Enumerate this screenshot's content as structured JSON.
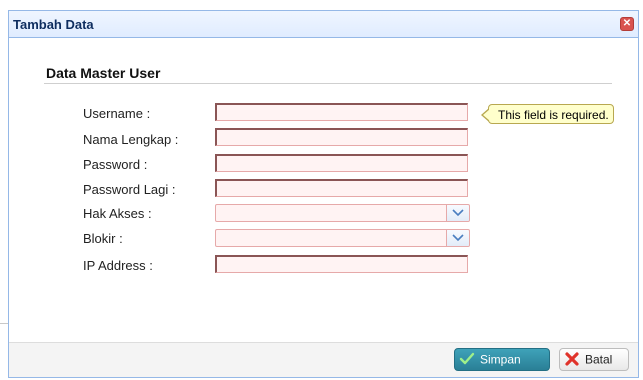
{
  "dialog": {
    "title": "Tambah Data",
    "close_icon": "close-icon"
  },
  "form": {
    "section_title": "Data Master User",
    "fields": [
      {
        "label": "Username :",
        "value": "",
        "type": "text"
      },
      {
        "label": "Nama Lengkap :",
        "value": "",
        "type": "text"
      },
      {
        "label": "Password :",
        "value": "",
        "type": "password"
      },
      {
        "label": "Password Lagi :",
        "value": "",
        "type": "password"
      },
      {
        "label": "Hak Akses :",
        "value": "",
        "type": "combobox"
      },
      {
        "label": "Blokir :",
        "value": "",
        "type": "combobox"
      },
      {
        "label": "IP Address :",
        "value": "",
        "type": "text"
      }
    ],
    "validation_tooltip": "This field is required."
  },
  "footer": {
    "save_label": "Simpan",
    "cancel_label": "Batal",
    "save_icon": "check-icon",
    "cancel_icon": "x-icon"
  },
  "colors": {
    "title_bar": "#e0ecff",
    "dialog_border": "#95b8e7",
    "invalid_field_bg": "#fff3f3",
    "save_button": "#2a7f96",
    "tooltip_bg": "#ffffcc"
  }
}
